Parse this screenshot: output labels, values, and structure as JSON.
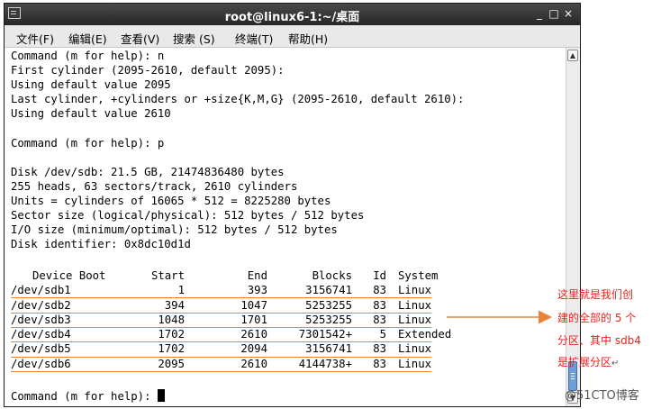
{
  "window": {
    "title": "root@linux6-1:~/桌面",
    "controls": {
      "minimize": "_",
      "maximize": "□",
      "close": "×"
    }
  },
  "menubar": {
    "items": [
      "文件(F)",
      "编辑(E)",
      "查看(V)",
      "搜索 (S)",
      "终端(T)",
      "帮助(H)"
    ]
  },
  "terminal": {
    "lines": [
      "Command (m for help): n",
      "First cylinder (2095-2610, default 2095):",
      "Using default value 2095",
      "Last cylinder, +cylinders or +size{K,M,G} (2095-2610, default 2610):",
      "Using default value 2610",
      "",
      "Command (m for help): p",
      "",
      "Disk /dev/sdb: 21.5 GB, 21474836480 bytes",
      "255 heads, 63 sectors/track, 2610 cylinders",
      "Units = cylinders of 16065 * 512 = 8225280 bytes",
      "Sector size (logical/physical): 512 bytes / 512 bytes",
      "I/O size (minimum/optimal): 512 bytes / 512 bytes",
      "Disk identifier: 0x8dc10d1d"
    ],
    "table": {
      "headers": [
        "Device Boot",
        "Start",
        "End",
        "Blocks",
        "Id",
        "System"
      ],
      "rows": [
        [
          "/dev/sdb1",
          "1",
          "393",
          "3156741",
          "83",
          "Linux"
        ],
        [
          "/dev/sdb2",
          "394",
          "1047",
          "5253255",
          "83",
          "Linux"
        ],
        [
          "/dev/sdb3",
          "1048",
          "1701",
          "5253255",
          "83",
          "Linux"
        ],
        [
          "/dev/sdb4",
          "1702",
          "2610",
          "7301542+",
          "5",
          "Extended"
        ],
        [
          "/dev/sdb5",
          "1702",
          "2094",
          "3156741",
          "83",
          "Linux"
        ],
        [
          "/dev/sdb6",
          "2095",
          "2610",
          "4144738+",
          "83",
          "Linux"
        ]
      ]
    },
    "prompt": "Command (m for help): "
  },
  "annotation": {
    "lines": [
      "这里就是我们创",
      "建的全部的 5 个",
      "分区、其中 sdb4",
      "是扩展分区"
    ],
    "return_mark": "↵",
    "color": "#e8231f"
  },
  "watermark": "@51CTO博客",
  "colors": {
    "underline": "#e8843c",
    "titlebar": "#2d2d2d",
    "scroll_thumb": "#6d9fd6"
  },
  "icons": {
    "window_menu": "window-menu-icon",
    "scroll_up": "scroll-up-arrow-icon",
    "scroll_down": "scroll-down-arrow-icon"
  }
}
